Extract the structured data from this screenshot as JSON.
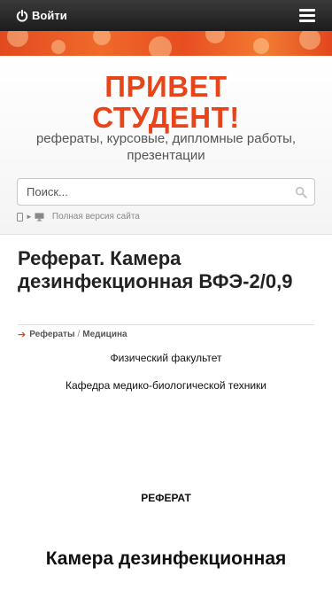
{
  "topbar": {
    "login_label": "Войти"
  },
  "header": {
    "title_line1": "ПРИВЕТ",
    "title_line2": "СТУДЕНТ!",
    "subtitle": "рефераты, курсовые, дипломные работы, презентации",
    "search_placeholder": "Поиск...",
    "full_version_label": "Полная версия сайта"
  },
  "content": {
    "page_title": "Реферат. Камера дезинфекционная ВФЭ-2/0,9",
    "breadcrumb": [
      "Рефераты",
      "Медицина"
    ],
    "faculty": "Физический факультет",
    "chair": "Кафедра медико-биологической техники",
    "referat_label": "РЕФЕРАТ",
    "big_title": "Камера дезинфекционная"
  },
  "colors": {
    "accent": "#e8441a",
    "topbar": "#262626"
  }
}
